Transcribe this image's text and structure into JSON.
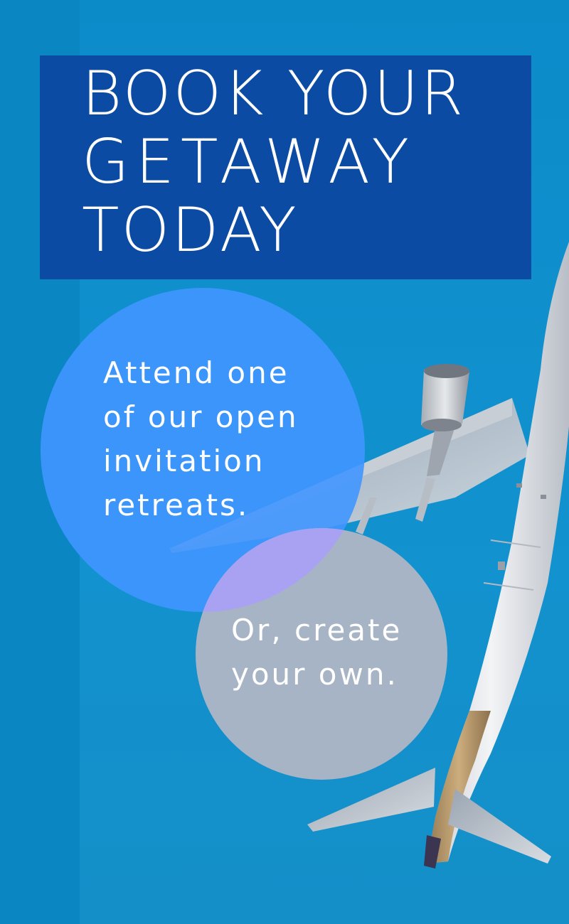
{
  "headline": {
    "lines": [
      "BOOK YOUR",
      "GETAWAY",
      "TODAY"
    ]
  },
  "offer_circle": {
    "lines": [
      "Attend one",
      "of our open",
      "invitation",
      "retreats."
    ]
  },
  "alternative_circle": {
    "lines": [
      "Or, create",
      "your own."
    ]
  },
  "colors": {
    "sky": "#0b8ac9",
    "headline_box": "#0b4ba3",
    "blue_circle": "#4096ff",
    "gray_circle": "#bcb8c4",
    "text": "#ffffff"
  }
}
